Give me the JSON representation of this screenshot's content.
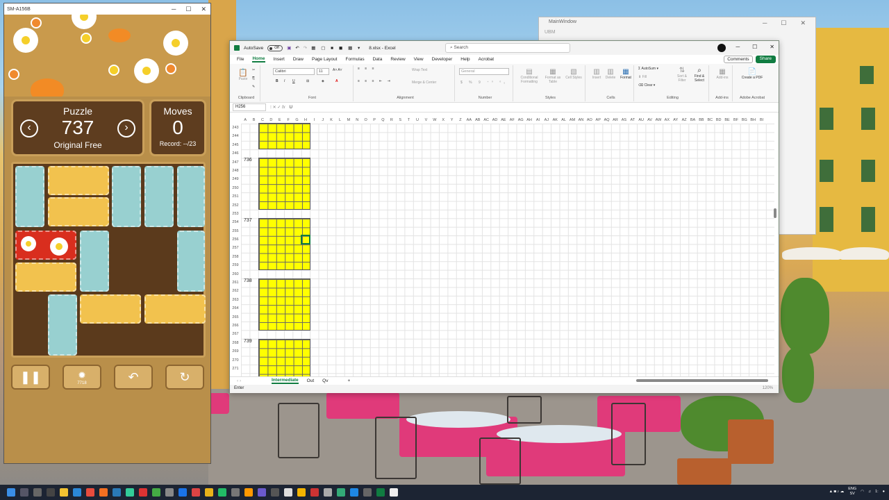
{
  "game_window": {
    "title": "SM-A156B",
    "puzzle_label": "Puzzle",
    "puzzle_number": "737",
    "mode_label": "Original Free",
    "moves_label": "Moves",
    "moves_value": "0",
    "record_label": "Record: --/23",
    "hint_count": "7718"
  },
  "main_window": {
    "title": "MainWindow",
    "subtitle": "UBM"
  },
  "excel": {
    "autosave_label": "AutoSave",
    "autosave_state": "Off",
    "file_name": "8.xlsx - Excel",
    "search_placeholder": "Search",
    "menu": [
      "File",
      "Home",
      "Insert",
      "Draw",
      "Page Layout",
      "Formulas",
      "Data",
      "Review",
      "View",
      "Developer",
      "Help",
      "Acrobat"
    ],
    "comments_label": "Comments",
    "share_label": "Share",
    "ribbon": {
      "paste": "Paste",
      "clipboard": "Clipboard",
      "font_name": "Calibri",
      "font_size": "11",
      "font": "Font",
      "wrap_text": "Wrap Text",
      "merge_center": "Merge & Center",
      "alignment": "Alignment",
      "number_format": "General",
      "number": "Number",
      "cond_format": "Conditional Formatting",
      "format_table": "Format as Table",
      "cell_styles": "Cell Styles",
      "styles": "Styles",
      "insert": "Insert",
      "delete": "Delete",
      "format": "Format",
      "cells": "Cells",
      "autosum": "AutoSum",
      "fill": "Fill",
      "clear": "Clear",
      "sort_filter": "Sort & Filter",
      "find_select": "Find & Select",
      "editing": "Editing",
      "addins": "Add-ins",
      "addins_group": "Add-ins",
      "create_pdf": "Create a PDF",
      "adobe": "Adobe Acrobat"
    },
    "name_box": "H256",
    "formula_value": "U",
    "columns": [
      "A",
      "B",
      "C",
      "D",
      "E",
      "F",
      "G",
      "H",
      "I",
      "J",
      "K",
      "L",
      "M",
      "N",
      "O",
      "P",
      "Q",
      "R",
      "S",
      "T",
      "U",
      "V",
      "W",
      "X",
      "Y",
      "Z",
      "AA",
      "AB",
      "AC",
      "AD",
      "AE",
      "AF",
      "AG",
      "AH",
      "AI",
      "AJ",
      "AK",
      "AL",
      "AM",
      "AN",
      "AO",
      "AP",
      "AQ",
      "AR",
      "AS",
      "AT",
      "AU",
      "AV",
      "AW",
      "AX",
      "AY",
      "AZ",
      "BA",
      "BB",
      "BC",
      "BD",
      "BE",
      "BF",
      "BG",
      "BH",
      "BI"
    ],
    "rows": [
      "243",
      "244",
      "245",
      "246",
      "247",
      "248",
      "249",
      "250",
      "251",
      "252",
      "253",
      "254",
      "255",
      "256",
      "257",
      "258",
      "259",
      "260",
      "261",
      "262",
      "263",
      "264",
      "265",
      "266",
      "267",
      "268",
      "269",
      "270",
      "271"
    ],
    "puzzles": [
      "736",
      "737",
      "738",
      "739"
    ],
    "sheet_tabs": [
      "Intermediate",
      "Out",
      "Qv"
    ],
    "status_mode": "Enter",
    "zoom": "120%"
  },
  "taskbar": {
    "lang1": "ENG",
    "lang2": "SV",
    "clock": "1:"
  }
}
